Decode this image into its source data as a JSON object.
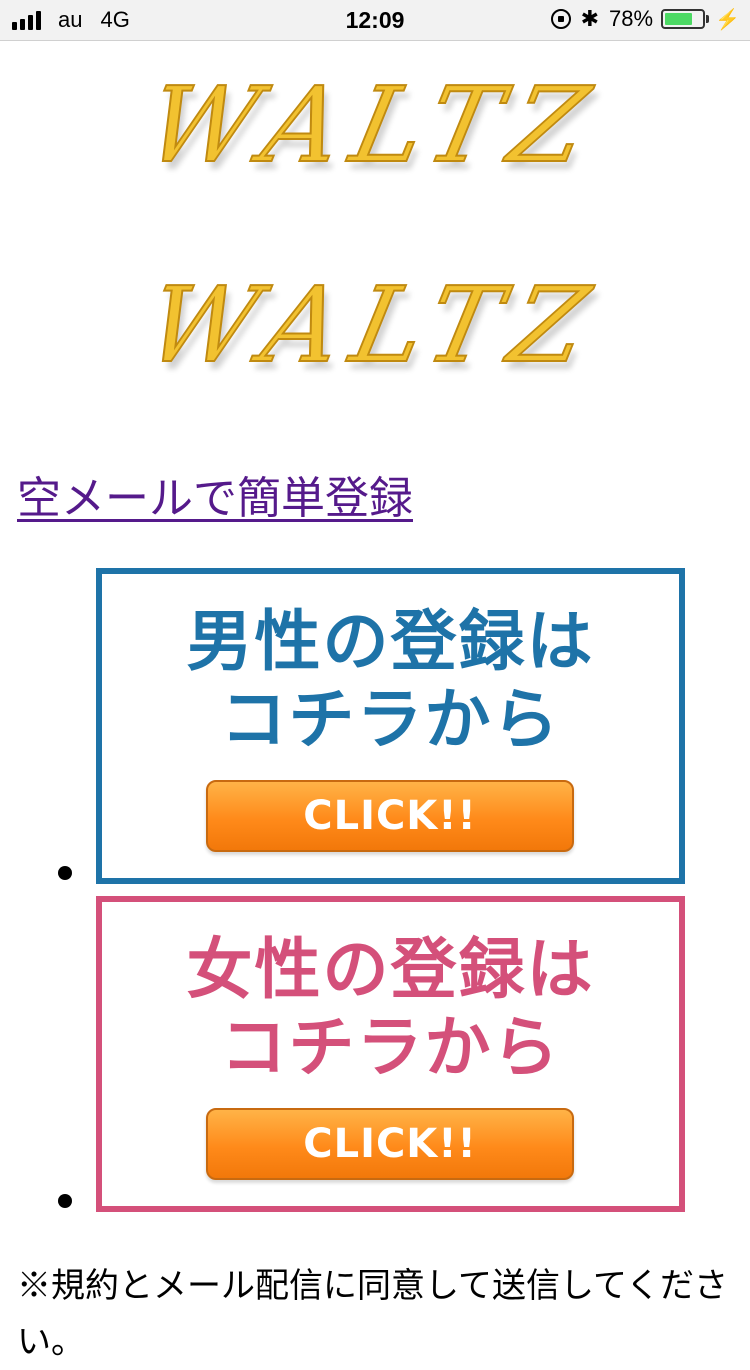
{
  "status_bar": {
    "carrier": "au",
    "network": "4G",
    "time": "12:09",
    "battery_percent": "78%",
    "battery_level": 0.78,
    "battery_color": "#4cd964"
  },
  "logos": {
    "logo_text": "WALTZ"
  },
  "registration": {
    "link_text": "空メールで簡単登録",
    "link_color": "#551a8b"
  },
  "banners": [
    {
      "line1": "男性の登録は",
      "line2": "コチラから",
      "button": "CLICK!!",
      "color": "#1e73a8"
    },
    {
      "line1": "女性の登録は",
      "line2": "コチラから",
      "button": "CLICK!!",
      "color": "#d4507a"
    }
  ],
  "notice": "※規約とメール配信に同意して送信してください。"
}
